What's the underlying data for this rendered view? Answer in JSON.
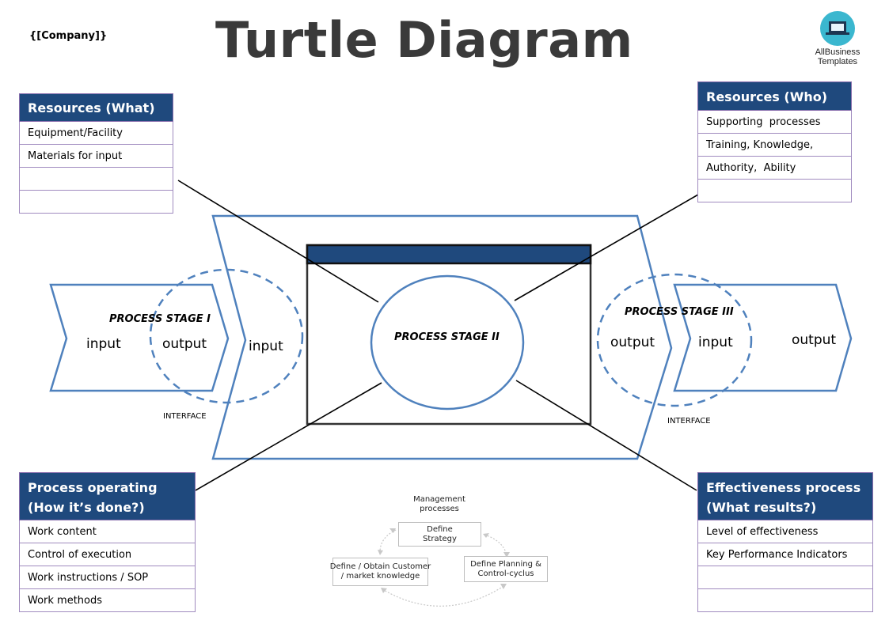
{
  "header": {
    "company": "{[Company]}",
    "title": "Turtle Diagram",
    "logo_icon": "laptop-icon",
    "logo_line1": "AllBusiness",
    "logo_line2": "Templates"
  },
  "colors": {
    "header_blue": "#1f497d",
    "shape_blue": "#4f81bd",
    "title_gray": "#3a3a3a",
    "table_border": "#a08bbf"
  },
  "resources_what": {
    "title": "Resources (What)",
    "rows": [
      "Equipment/Facility",
      "Materials for input",
      "",
      ""
    ]
  },
  "resources_who": {
    "title": "Resources (Who)",
    "rows": [
      "Supporting  processes",
      "Training, Knowledge,",
      "Authority,  Ability",
      ""
    ]
  },
  "process_operating": {
    "title_line1": "Process operating",
    "title_line2": "(How it’s done?)",
    "rows": [
      "Work content",
      "Control of execution",
      "Work instructions / SOP",
      "Work methods"
    ]
  },
  "effectiveness": {
    "title_line1": "Effectiveness process",
    "title_line2": "(What results?)",
    "rows": [
      "Level of effectiveness",
      "Key Performance Indicators",
      "",
      ""
    ]
  },
  "diagram": {
    "stage1": "PROCESS STAGE I",
    "stage2": "PROCESS STAGE II",
    "stage3": "PROCESS STAGE III",
    "s1_input": "input",
    "s1_output": "output",
    "s2_input": "input",
    "s2_output": "output",
    "s3_input": "input",
    "s3_output": "output",
    "interface_left": "INTERFACE",
    "interface_right": "INTERFACE"
  },
  "management": {
    "title_line1": "Management",
    "title_line2": "processes",
    "strategy_line1": "Define",
    "strategy_line2": "Strategy",
    "customer_line1": "Define / Obtain Customer",
    "customer_line2": "/ market knowledge",
    "planning_line1": "Define Planning &",
    "planning_line2": "Control-cyclus"
  }
}
